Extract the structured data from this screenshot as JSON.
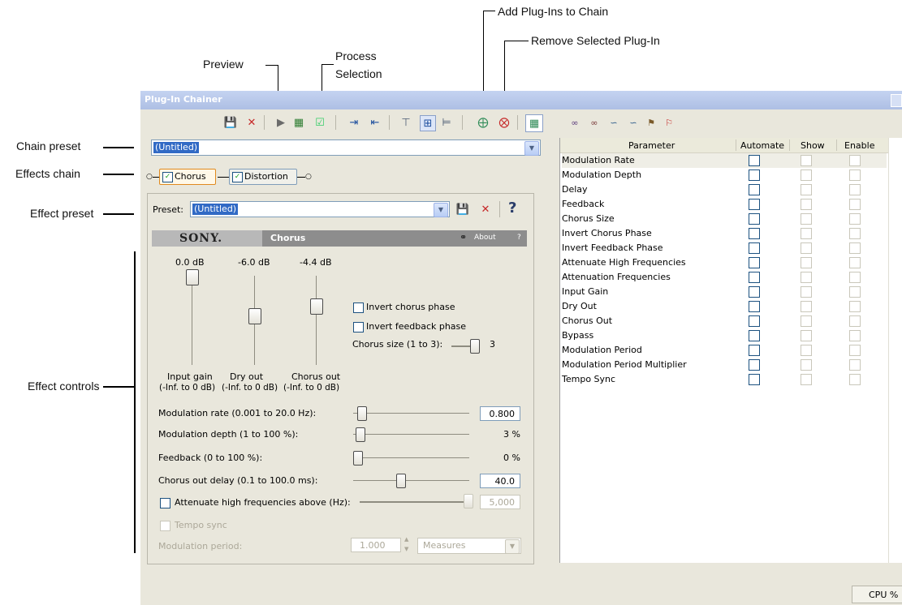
{
  "callouts": {
    "add_plugins": "Add Plug-Ins to Chain",
    "remove_plugin": "Remove Selected Plug-In",
    "preview": "Preview",
    "process_selection_1": "Process",
    "process_selection_2": "Selection",
    "chain_preset": "Chain preset",
    "effects_chain": "Effects chain",
    "effect_preset": "Effect preset",
    "effect_controls": "Effect controls"
  },
  "window": {
    "title": "Plug-In Chainer"
  },
  "chain_preset": {
    "value": "(Untitled)"
  },
  "effects_chain": {
    "items": [
      "Chorus",
      "Distortion"
    ]
  },
  "effect_preset": {
    "label": "Preset:",
    "value": "(Untitled)",
    "help": "?"
  },
  "plugin_header": {
    "brand": "SONY.",
    "name": "Chorus",
    "about": "About",
    "help": "?"
  },
  "vsliders": [
    {
      "value": "0.0 dB",
      "label": "Input gain",
      "range": "(-Inf. to 0 dB)",
      "level": 1.0
    },
    {
      "value": "-6.0 dB",
      "label": "Dry out",
      "range": "(-Inf. to 0 dB)",
      "level": 0.5
    },
    {
      "value": "-4.4 dB",
      "label": "Chorus out",
      "range": "(-Inf. to 0 dB)",
      "level": 0.63
    }
  ],
  "options": {
    "invert_chorus": "Invert chorus phase",
    "invert_feedback": "Invert feedback phase",
    "chorus_size_label": "Chorus size (1 to 3):",
    "chorus_size_value": "3"
  },
  "params": [
    {
      "label": "Modulation rate (0.001 to 20.0 Hz):",
      "value": "0.800",
      "boxed": true,
      "level": 0.04
    },
    {
      "label": "Modulation depth (1 to 100 %):",
      "value": "3 %",
      "boxed": false,
      "level": 0.02
    },
    {
      "label": "Feedback (0 to 100 %):",
      "value": "0 %",
      "boxed": false,
      "level": 0.0
    },
    {
      "label": "Chorus out delay (0.1 to 100.0 ms):",
      "value": "40.0",
      "boxed": true,
      "level": 0.4
    }
  ],
  "attenuate": {
    "label": "Attenuate high frequencies above (Hz):",
    "value": "5,000"
  },
  "tempo_sync": {
    "label": "Tempo sync"
  },
  "modulation_period": {
    "label": "Modulation period:",
    "value": "1.000",
    "unit": "Measures"
  },
  "param_table": {
    "headers": [
      "Parameter",
      "Automate",
      "Show",
      "Enable"
    ],
    "rows": [
      "Modulation Rate",
      "Modulation Depth",
      "Delay",
      "Feedback",
      "Chorus Size",
      "Invert Chorus Phase",
      "Invert Feedback Phase",
      "Attenuate High Frequencies",
      "Attenuation Frequencies",
      "Input Gain",
      "Dry Out",
      "Chorus Out",
      "Bypass",
      "Modulation Period",
      "Modulation Period Multiplier",
      "Tempo Sync"
    ]
  },
  "status_bar": {
    "cpu": "CPU %"
  }
}
